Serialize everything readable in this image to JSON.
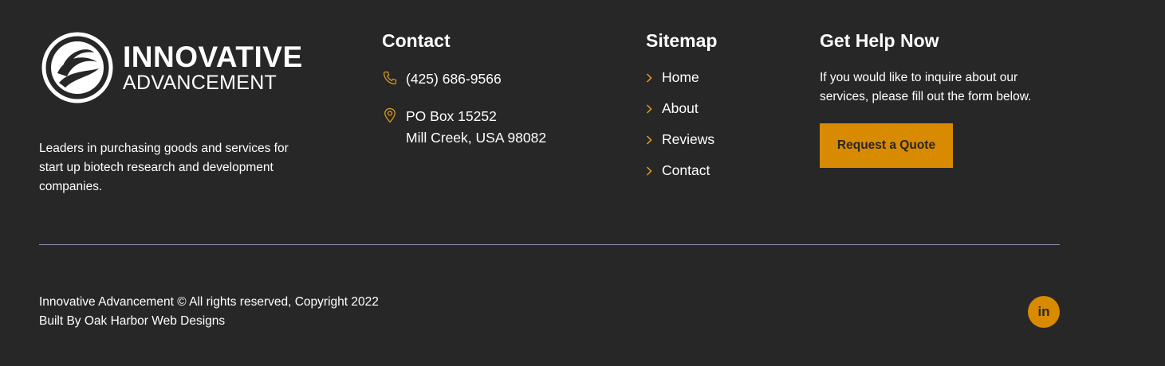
{
  "brand": {
    "line1": "INNOVATIVE",
    "line2": "ADVANCEMENT",
    "tagline": "Leaders in purchasing goods and services for start up biotech research and development companies."
  },
  "contact": {
    "heading": "Contact",
    "phone": "(425) 686-9566",
    "address_line1": "PO Box 15252",
    "address_line2": "Mill Creek, USA 98082",
    "phone_icon": "phone-icon",
    "location_icon": "map-pin-icon"
  },
  "sitemap": {
    "heading": "Sitemap",
    "items": [
      {
        "label": "Home"
      },
      {
        "label": "About"
      },
      {
        "label": "Reviews"
      },
      {
        "label": "Contact"
      }
    ]
  },
  "help": {
    "heading": "Get Help Now",
    "text": "If you would like to inquire about our services, please fill out the form below.",
    "button_label": "Request a Quote"
  },
  "footer": {
    "copyright": "Innovative Advancement © All rights reserved, Copyright 2022",
    "built_by": "Built By Oak Harbor Web Designs",
    "social_label": "in"
  },
  "colors": {
    "background": "#272727",
    "accent": "#d88a00",
    "text": "#ffffff",
    "divider": "#8f8fb2"
  }
}
